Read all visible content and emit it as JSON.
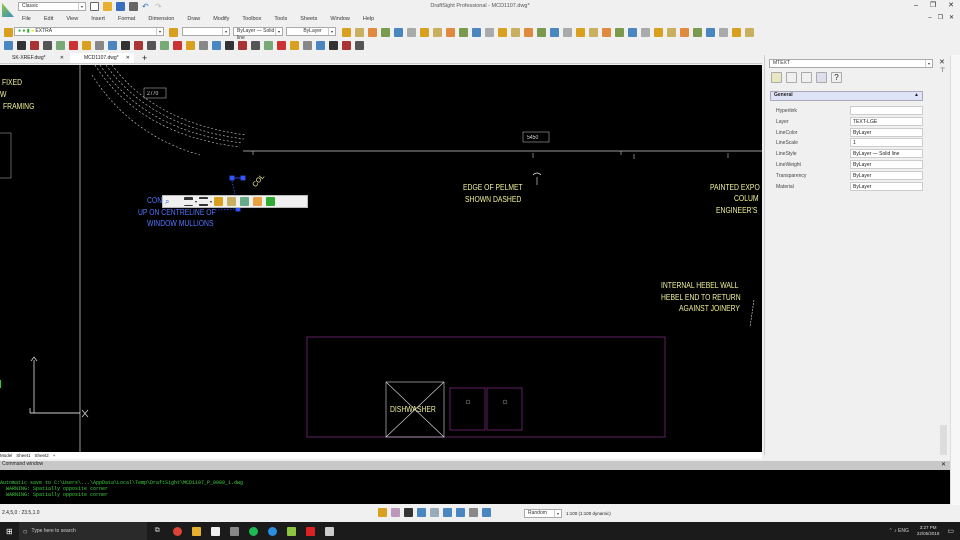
{
  "app": {
    "title": "DraftSight Professional - MCD1107.dwg*",
    "workspace": "Classic"
  },
  "menu": [
    "File",
    "Edit",
    "View",
    "Insert",
    "Format",
    "Dimension",
    "Draw",
    "Modify",
    "Toolbox",
    "Tools",
    "Sheets",
    "Window",
    "Help"
  ],
  "toolbar": {
    "layer": "EXTRA",
    "color": "",
    "linestyle": "ByLayer — Solid line",
    "lineweight": "ByLayer"
  },
  "doc_tabs": [
    {
      "label": "SK-XREF.dwg*"
    },
    {
      "label": "MCD1107.dwg*",
      "active": true
    }
  ],
  "drawing": {
    "labels": [
      "FIXED",
      "W",
      "FRAMING",
      "CON",
      "UP ON CENTRELINE OF",
      "WINDOW MULLIONS",
      "COL",
      "EDGE OF PELMET",
      "SHOWN DASHED",
      "PAINTED EXPO",
      "COLUM",
      "ENGINEER'S",
      "INTERNAL HEBEL WALL",
      "HEBEL END TO RETURN",
      "AGAINST JOINERY",
      "DISHWASHER"
    ],
    "dims": [
      "2770",
      "5450"
    ],
    "colors": {
      "background": "#000000",
      "text": "#f2f29a",
      "selected": "#3355ff",
      "joinery": "#7a2a7a"
    }
  },
  "layout_tabs": [
    "Model",
    "Sheet1",
    "Sheet2"
  ],
  "properties": {
    "selector": "MTEXT",
    "section": "General",
    "rows": [
      {
        "key": "Hyperlink",
        "value": ""
      },
      {
        "key": "Layer",
        "value": "TEXT-LGE"
      },
      {
        "key": "LineColor",
        "value": "ByLayer"
      },
      {
        "key": "LineScale",
        "value": "1"
      },
      {
        "key": "LineStyle",
        "value": "ByLayer — Solid line"
      },
      {
        "key": "LineWeight",
        "value": "ByLayer"
      },
      {
        "key": "Transparency",
        "value": "ByLayer"
      },
      {
        "key": "Material",
        "value": "ByLayer"
      }
    ]
  },
  "command": {
    "title": "Command window",
    "lines": [
      "Automatic save to C:\\Users\\...\\AppData\\Local\\Temp\\DraftSight\\MCD1107_P_0000_1.dwg",
      "WARNING: Spatially opposite corner",
      "WARNING: Spatially opposite corner"
    ]
  },
  "status": {
    "coords": "2.4,5,0 : 23.5,1.0",
    "annotation_scale": "Random",
    "scale_text": "1:100 (1:100 dynamic)"
  },
  "taskbar": {
    "search_placeholder": "Type here to search",
    "time": "3:27 PM",
    "date": "22/05/2019"
  }
}
